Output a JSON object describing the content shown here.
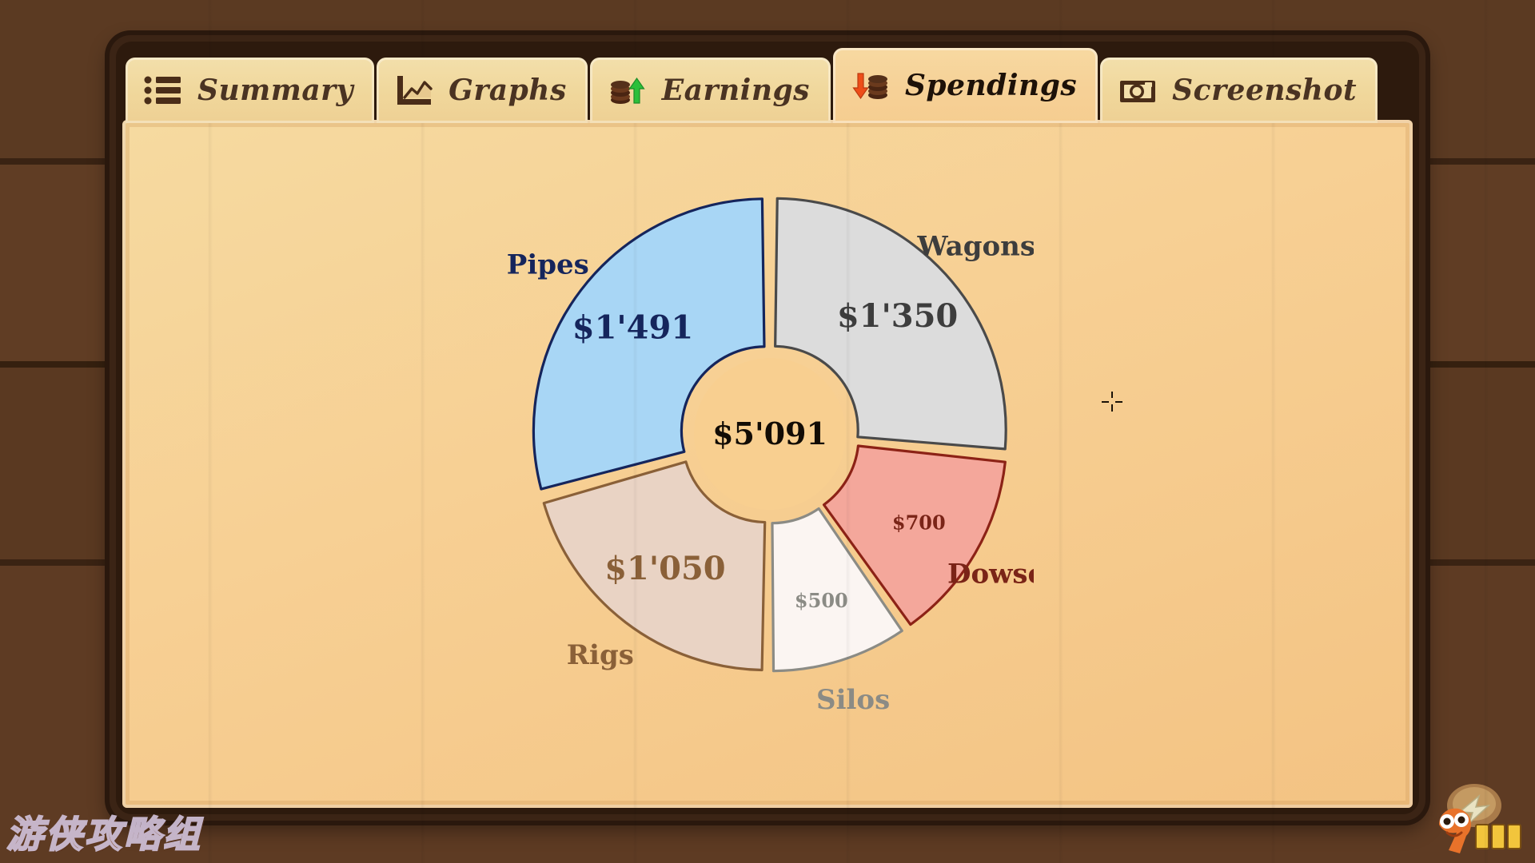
{
  "window": {
    "tabs": [
      {
        "id": "summary",
        "label": "Summary",
        "icon": "list-icon",
        "active": false
      },
      {
        "id": "graphs",
        "label": "Graphs",
        "icon": "line-chart-icon",
        "active": false
      },
      {
        "id": "earnings",
        "label": "Earnings",
        "icon": "coins-up-icon",
        "active": false
      },
      {
        "id": "spendings",
        "label": "Spendings",
        "icon": "coins-down-icon",
        "active": true
      },
      {
        "id": "screenshot",
        "label": "Screenshot",
        "icon": "camera-icon",
        "active": false
      }
    ]
  },
  "chart_data": {
    "type": "pie",
    "variant": "donut-exploded",
    "title": "Spendings",
    "center_label": "$5'091",
    "total": 5091,
    "currency_symbol": "$",
    "thousands_separator": "'",
    "start_angle_deg": 0,
    "direction": "clockwise",
    "legend": "inline-labels",
    "categories": [
      "Wagons",
      "Dowsers",
      "Silos",
      "Rigs",
      "Pipes"
    ],
    "values": [
      1350,
      700,
      500,
      1050,
      1491
    ],
    "value_labels": [
      "$1'350",
      "$700",
      "$500",
      "$1'050",
      "$1'491"
    ],
    "percentages": [
      26.5,
      13.8,
      9.8,
      20.6,
      29.3
    ],
    "slices": [
      {
        "name": "Wagons",
        "value": 1350,
        "value_label": "$1'350",
        "fill": "#dcdcdc",
        "stroke": "#4a4a4a",
        "text": "#3d3d3d"
      },
      {
        "name": "Dowsers",
        "value": 700,
        "value_label": "$700",
        "fill": "#f4a79b",
        "stroke": "#8c2216",
        "text": "#7a2417"
      },
      {
        "name": "Silos",
        "value": 500,
        "value_label": "$500",
        "fill": "#fbf5f2",
        "stroke": "#8b8b85",
        "text": "#8b8b85"
      },
      {
        "name": "Rigs",
        "value": 1050,
        "value_label": "$1'050",
        "fill": "#e9d3c4",
        "stroke": "#8a6038",
        "text": "#8a6038"
      },
      {
        "name": "Pipes",
        "value": 1491,
        "value_label": "$1'491",
        "fill": "#a8d6f5",
        "stroke": "#15255c",
        "text": "#15255c"
      }
    ],
    "colors": {
      "panel_background": "#f7cf93",
      "center_hub": "#f8cf90",
      "center_text": "#120c05"
    }
  },
  "watermarks": {
    "text": "游侠攻略组",
    "logo_alt": "9game-logo"
  }
}
